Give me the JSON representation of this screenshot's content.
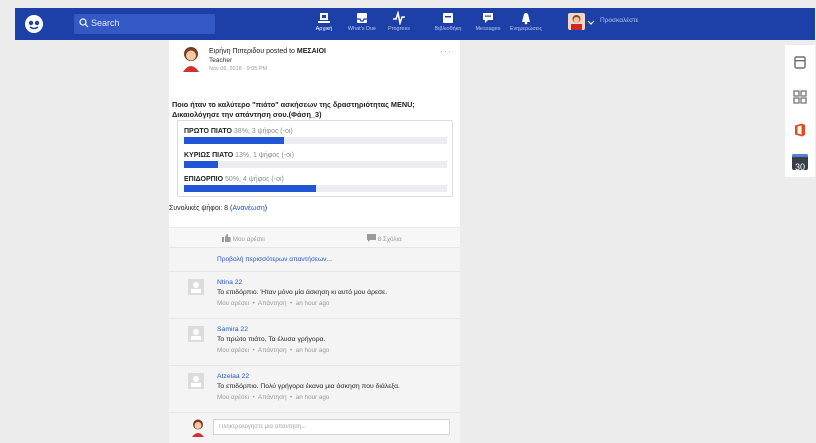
{
  "topbar": {
    "search_placeholder": "Search",
    "nav": [
      {
        "label": "Αρχική",
        "icon": "home-icon"
      },
      {
        "label": "What's Due",
        "icon": "inbox-icon"
      },
      {
        "label": "Progress",
        "icon": "progress-icon"
      },
      {
        "label": "Βιβλιοθήκη",
        "icon": "library-icon"
      },
      {
        "label": "Messages",
        "icon": "messages-icon"
      },
      {
        "label": "Ενημερώσεις",
        "icon": "notifications-icon"
      }
    ],
    "user_name": "Προσκαλέστε"
  },
  "post": {
    "author": "Ειρήνη Πιπεριδου",
    "posted_to": "posted to",
    "group": "ΜΕΣΑΙΟΙ",
    "role": "Teacher",
    "date": "Nov 06, 2018 · 9:05 PM",
    "menu": "···",
    "question": "Ποιο ήταν το καλύτερο \"πιάτο\" ασκήσεων της δραστηριότητας MENU; Δικαιολόγησε την απάντηση σου.(Φάση_3)",
    "poll": [
      {
        "option": "ΠΡΩΤΟ ΠΙΑΤΟ",
        "meta": "38%, 3 ψήφος (-οι)",
        "fraction": 0.38
      },
      {
        "option": "ΚΥΡΙΩΣ ΠΙΑΤΟ",
        "meta": "13%, 1 ψήφος (-οι)",
        "fraction": 0.13
      },
      {
        "option": "ΕΠΙΔΟΡΠΙΟ",
        "meta": "50%, 4 ψήφος (-οι)",
        "fraction": 0.5
      }
    ],
    "total_label": "Συνολικές ψήφοι: 8",
    "refresh_label": "Ανανέωση",
    "like_label": "Μου αρέσει",
    "comments_label": "8 Σχόλια",
    "more_replies": "Προβολή περισσότερων απαντήσεων..."
  },
  "comments": [
    {
      "name": "Ntina 22",
      "text": "Το επιδόρπιο. Ήταν μόνο μία άσκηση κι αυτό μου άρεσε.",
      "like": "Μου αρέσει",
      "reply": "Απάντηση",
      "time": "an hour ago"
    },
    {
      "name": "Samira 22",
      "text": "Το πρώτο πιάτο, Τα έλυσα γρήγορα.",
      "like": "Μου αρέσει",
      "reply": "Απάντηση",
      "time": "an hour ago"
    },
    {
      "name": "Atzelaa 22",
      "text": "Το επιδόρπιο. Πολύ γρήγορα έκανα μια άσκηση που διάλεξα.",
      "like": "Μου αρέσει",
      "reply": "Απάντηση",
      "time": "an hour ago"
    }
  ],
  "reply_placeholder": "Πληκτρολογήστε μία απάντηση...",
  "rail": {
    "items": [
      "backpack-icon",
      "apps-grid-icon",
      "office-icon",
      "calendar-icon"
    ],
    "calendar_day": "30"
  },
  "colors": {
    "brand": "#1c3fa8",
    "accent": "#2155d6",
    "office": "#e34b1b"
  }
}
